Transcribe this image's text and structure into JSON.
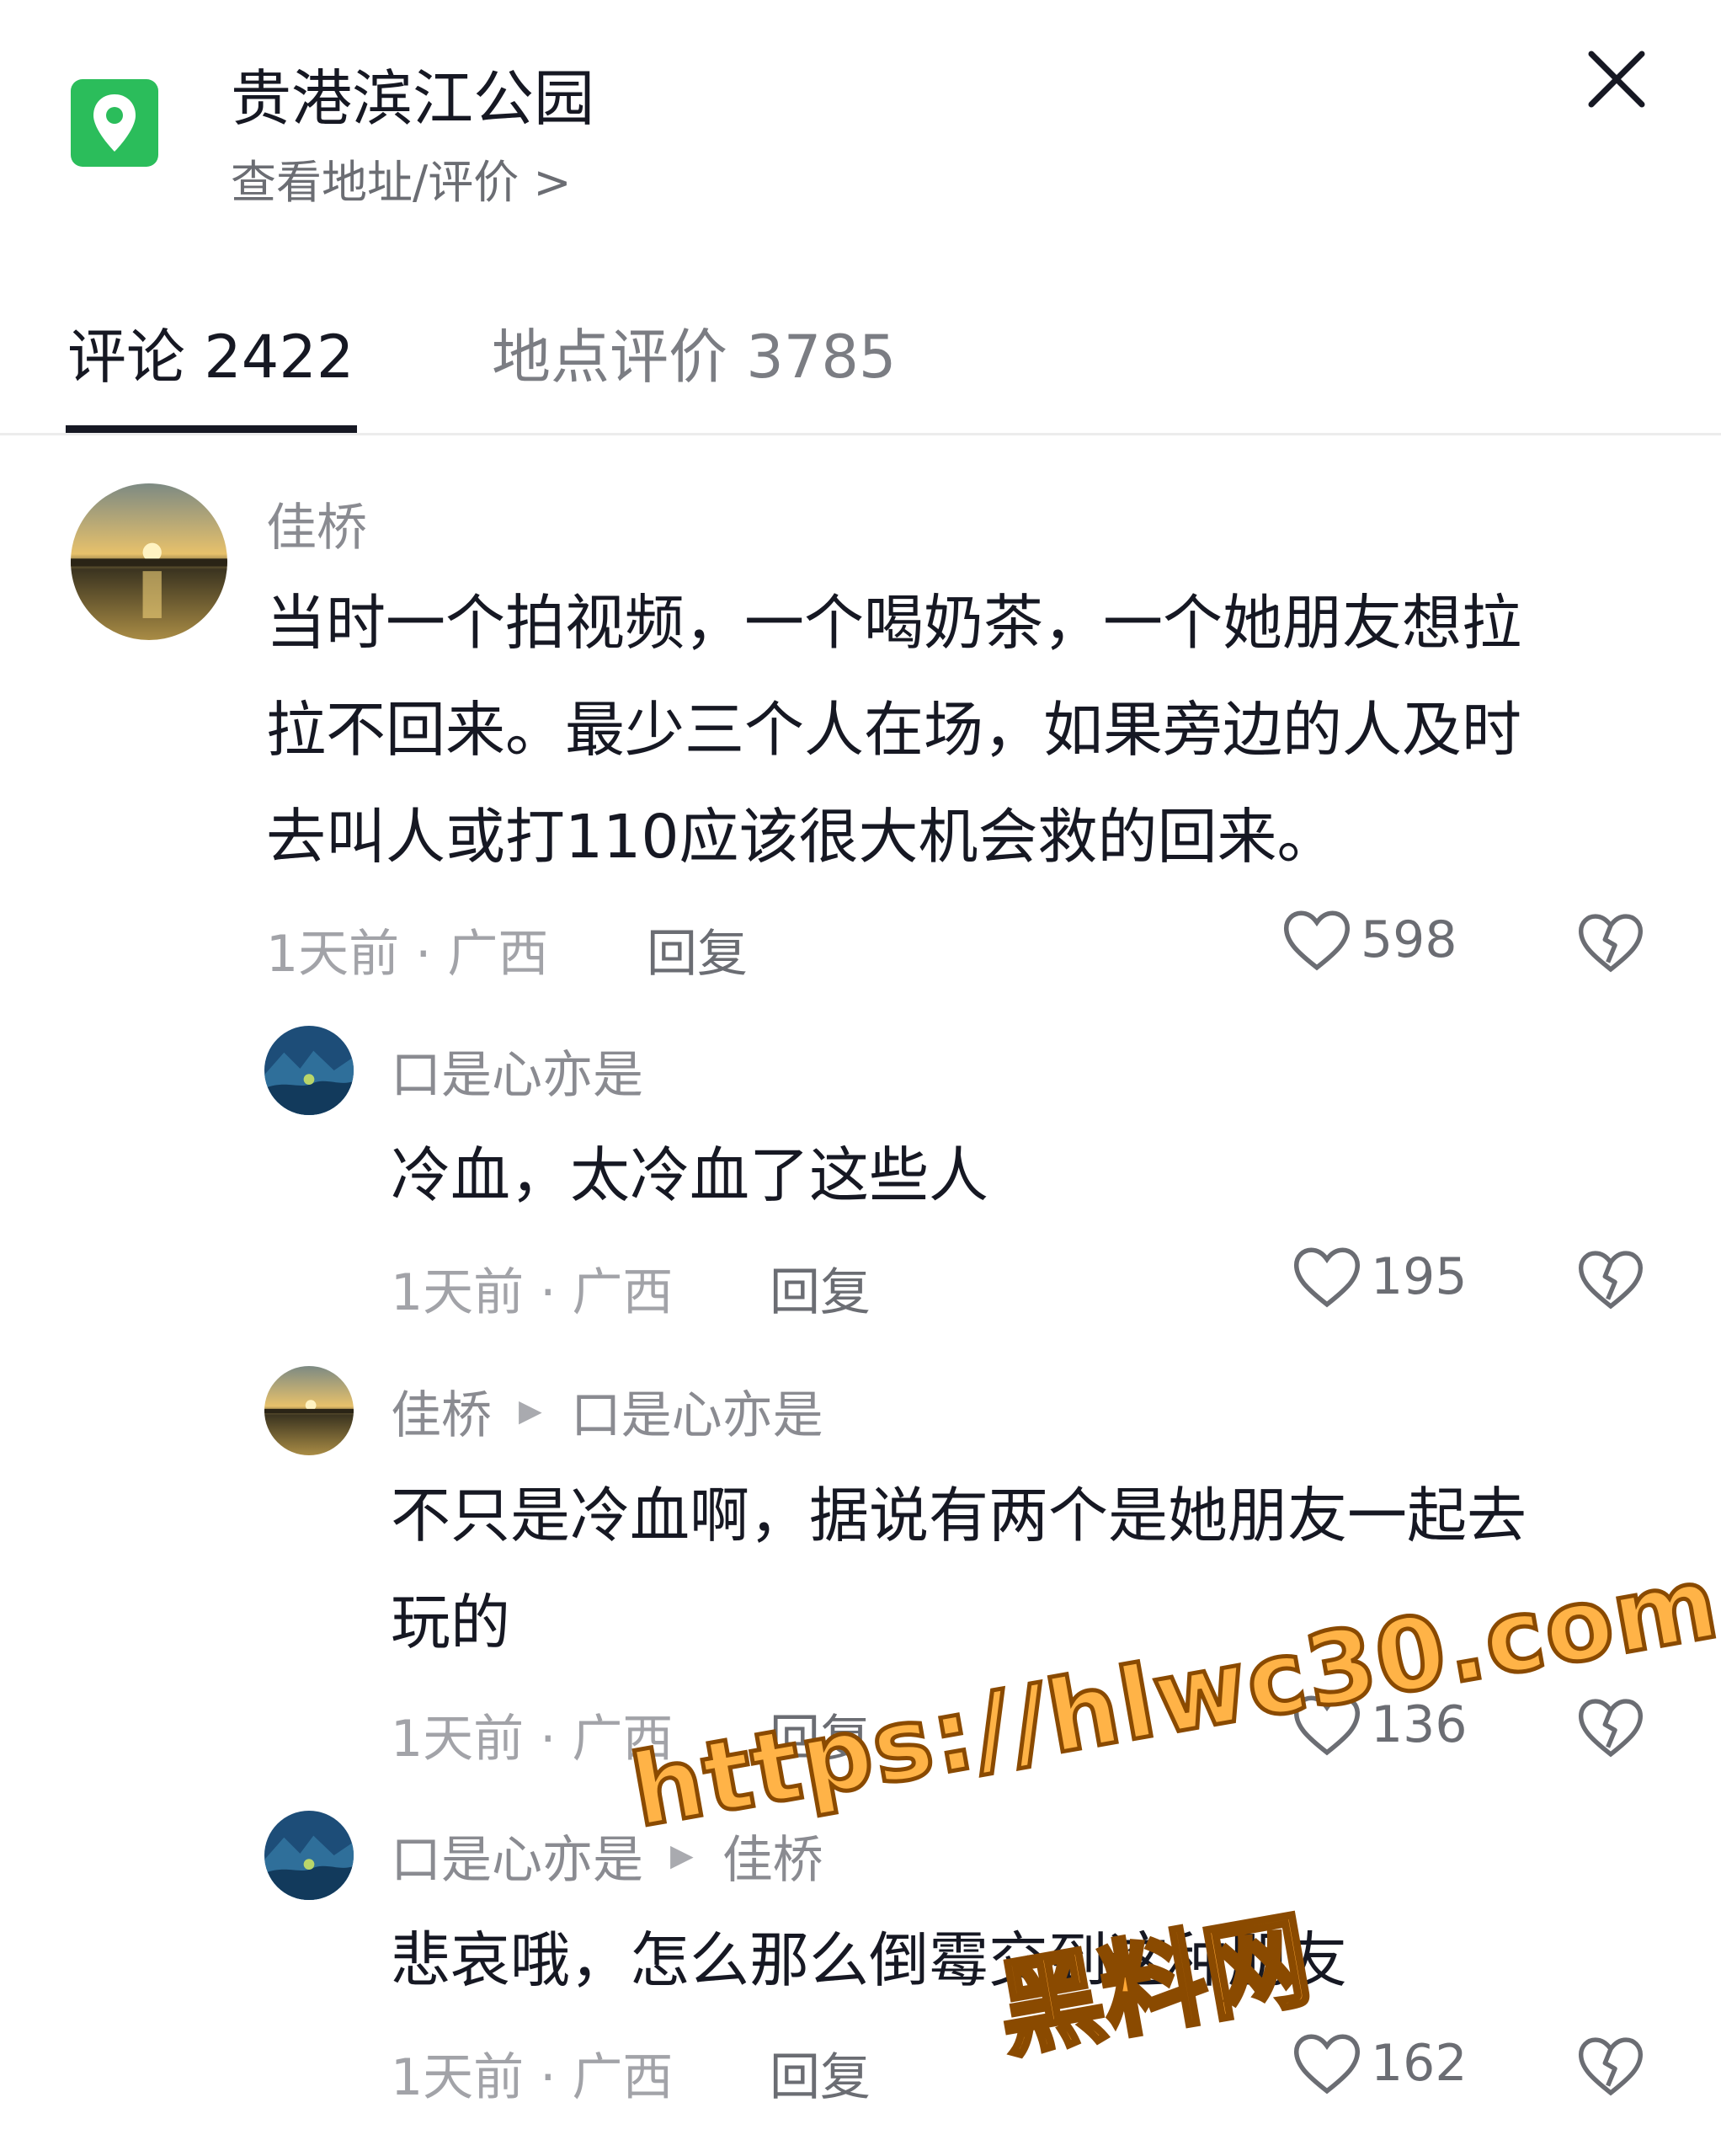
{
  "header": {
    "place_name": "贵港滨江公园",
    "place_link": "查看地址/评价 >"
  },
  "tabs": [
    {
      "label": "评论 2422",
      "active": true
    },
    {
      "label": "地点评价 3785",
      "active": false
    }
  ],
  "comments": [
    {
      "user": "佳桥",
      "avatar": "sunset-lake",
      "lines": [
        "当时一个拍视频，一个喝奶茶，一个她朋友想拉",
        "拉不回来。最少三个人在场，如果旁边的人及时",
        "去叫人或打110应该很大机会救的回来。"
      ],
      "time_loc": "1天前 · 广西",
      "reply_label": "回复",
      "likes": "598"
    },
    {
      "user": "口是心亦是",
      "avatar": "blue-mountain",
      "lines": [
        "冷血，太冷血了这些人"
      ],
      "time_loc": "1天前 · 广西",
      "reply_label": "回复",
      "likes": "195"
    },
    {
      "user": "佳桥",
      "reply_to": "口是心亦是",
      "avatar": "sunset-lake",
      "lines": [
        "不只是冷血啊，据说有两个是她朋友一起去",
        "玩的"
      ],
      "time_loc": "1天前 · 广西",
      "reply_label": "回复",
      "likes": "136"
    },
    {
      "user": "口是心亦是",
      "reply_to": "佳桥",
      "avatar": "blue-mountain",
      "lines": [
        "悲哀哦，怎么那么倒霉交到这种朋友"
      ],
      "time_loc": "1天前 · 广西",
      "reply_label": "回复",
      "likes": "162"
    }
  ],
  "watermark": {
    "url": "https://hlwc30.com",
    "name": "黑料网"
  },
  "colors": {
    "accent_green": "#2bbd5b",
    "text_primary": "#161823",
    "text_secondary": "#8a8b91",
    "watermark_fill": "#ffb347"
  }
}
